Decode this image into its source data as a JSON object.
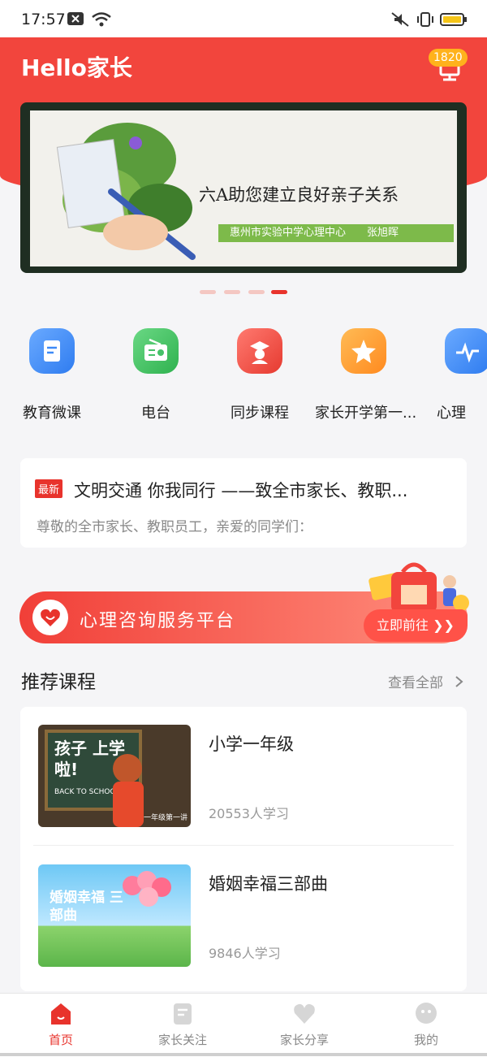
{
  "status_bar": {
    "time": "17:57"
  },
  "header": {
    "title": "Hello家长",
    "message_badge": "1820"
  },
  "banner": {
    "title": "六A助您建立良好亲子关系",
    "subtitle": "惠州市实验中学心理中心　　张旭晖",
    "page_count": 4,
    "active_index": 3
  },
  "quick_nav": [
    {
      "label": "教育微课",
      "icon": "document-icon",
      "color": "#3d8af7"
    },
    {
      "label": "电台",
      "icon": "radio-icon",
      "color": "#45c168"
    },
    {
      "label": "同步课程",
      "icon": "graduate-icon",
      "color": "#f2453d"
    },
    {
      "label": "家长开学第一...",
      "icon": "star-icon",
      "color": "#ff9a2c"
    },
    {
      "label": "心理",
      "icon": "heartbeat-icon",
      "color": "#3d8af7"
    }
  ],
  "news": {
    "tag": "最新",
    "title": "文明交通 你我同行 ——致全市家长、教职...",
    "subtitle": "尊敬的全市家长、教职员工，亲爱的同学们："
  },
  "consult": {
    "title": "心理咨询服务平台",
    "go_label": "立即前往 ❯❯"
  },
  "recommended": {
    "title": "推荐课程",
    "more_label": "查看全部",
    "courses": [
      {
        "name": "小学一年级",
        "count": "20553人学习",
        "thumb_text": "孩子 上学啦!",
        "thumb_caption": "BACK TO SCHOOL",
        "thumb_corner": "一年级第一讲"
      },
      {
        "name": "婚姻幸福三部曲",
        "count": "9846人学习",
        "thumb_text": "婚姻幸福 三部曲"
      }
    ]
  },
  "tabbar": [
    {
      "label": "首页",
      "active": true
    },
    {
      "label": "家长关注",
      "active": false
    },
    {
      "label": "家长分享",
      "active": false
    },
    {
      "label": "我的",
      "active": false
    }
  ]
}
